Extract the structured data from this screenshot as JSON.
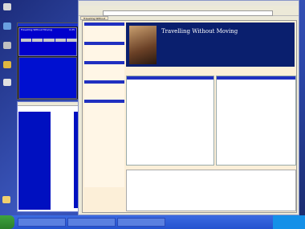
{
  "winamp": {
    "title": "Travelling Without Moving",
    "time": "0:25"
  },
  "browser": {
    "banner_title": "Travelling Without Moving",
    "tab_label": "Travelling Without"
  }
}
